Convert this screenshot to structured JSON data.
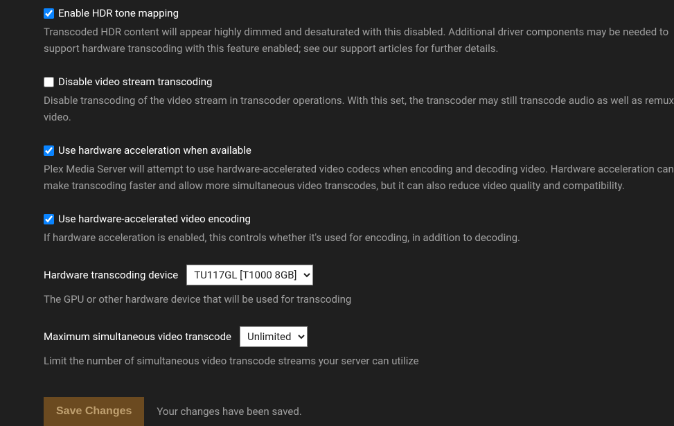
{
  "settings": {
    "hdr_tone_mapping": {
      "label": "Enable HDR tone mapping",
      "description": "Transcoded HDR content will appear highly dimmed and desaturated with this disabled. Additional driver components may be needed to support hardware transcoding with this feature enabled; see our support articles for further details."
    },
    "disable_video_stream_transcoding": {
      "label": "Disable video stream transcoding",
      "description": "Disable transcoding of the video stream in transcoder operations. With this set, the transcoder may still transcode audio as well as remux video."
    },
    "hardware_acceleration": {
      "label": "Use hardware acceleration when available",
      "description": "Plex Media Server will attempt to use hardware-accelerated video codecs when encoding and decoding video. Hardware acceleration can make transcoding faster and allow more simultaneous video transcodes, but it can also reduce video quality and compatibility."
    },
    "hardware_accelerated_encoding": {
      "label": "Use hardware-accelerated video encoding",
      "description": "If hardware acceleration is enabled, this controls whether it's used for encoding, in addition to decoding."
    },
    "transcoding_device": {
      "label": "Hardware transcoding device",
      "selected": "TU117GL [T1000 8GB]",
      "description": "The GPU or other hardware device that will be used for transcoding"
    },
    "max_simultaneous_transcode": {
      "label": "Maximum simultaneous video transcode",
      "selected": "Unlimited",
      "description": "Limit the number of simultaneous video transcode streams your server can utilize"
    }
  },
  "actions": {
    "save_label": "Save Changes",
    "save_status": "Your changes have been saved."
  }
}
